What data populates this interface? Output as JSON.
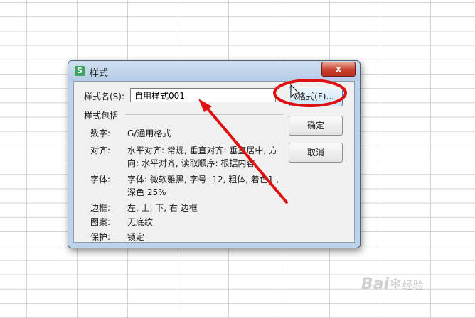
{
  "dialog": {
    "title": "样式",
    "app_icon": "S",
    "close_glyph": "x",
    "style_name_label": "样式名(S):",
    "style_name_value": "自用样式001",
    "includes_label": "样式包括",
    "properties": [
      {
        "label": "数字:",
        "value": "G/通用格式"
      },
      {
        "label": "对齐:",
        "value_line1": "水平对齐: 常规, 垂直对齐: 垂直居中, 方",
        "value_line2": "向: 水平对齐, 读取顺序: 根据内容"
      },
      {
        "label": "字体:",
        "value_line1": "字体: 微软雅黑, 字号: 12, 粗体, 着色1 ,",
        "value_line2": "深色 25%"
      },
      {
        "label": "边框:",
        "value": "左, 上, 下, 右 边框"
      },
      {
        "label": "图案:",
        "value": "无底纹"
      },
      {
        "label": "保护:",
        "value": "锁定"
      }
    ],
    "buttons": {
      "format": "格式(F)...",
      "ok": "确定",
      "cancel": "取消"
    }
  },
  "annotation_color": "#e01010",
  "watermark": {
    "text": "Bai",
    "text2": "经验",
    "icon": "paw-icon"
  }
}
